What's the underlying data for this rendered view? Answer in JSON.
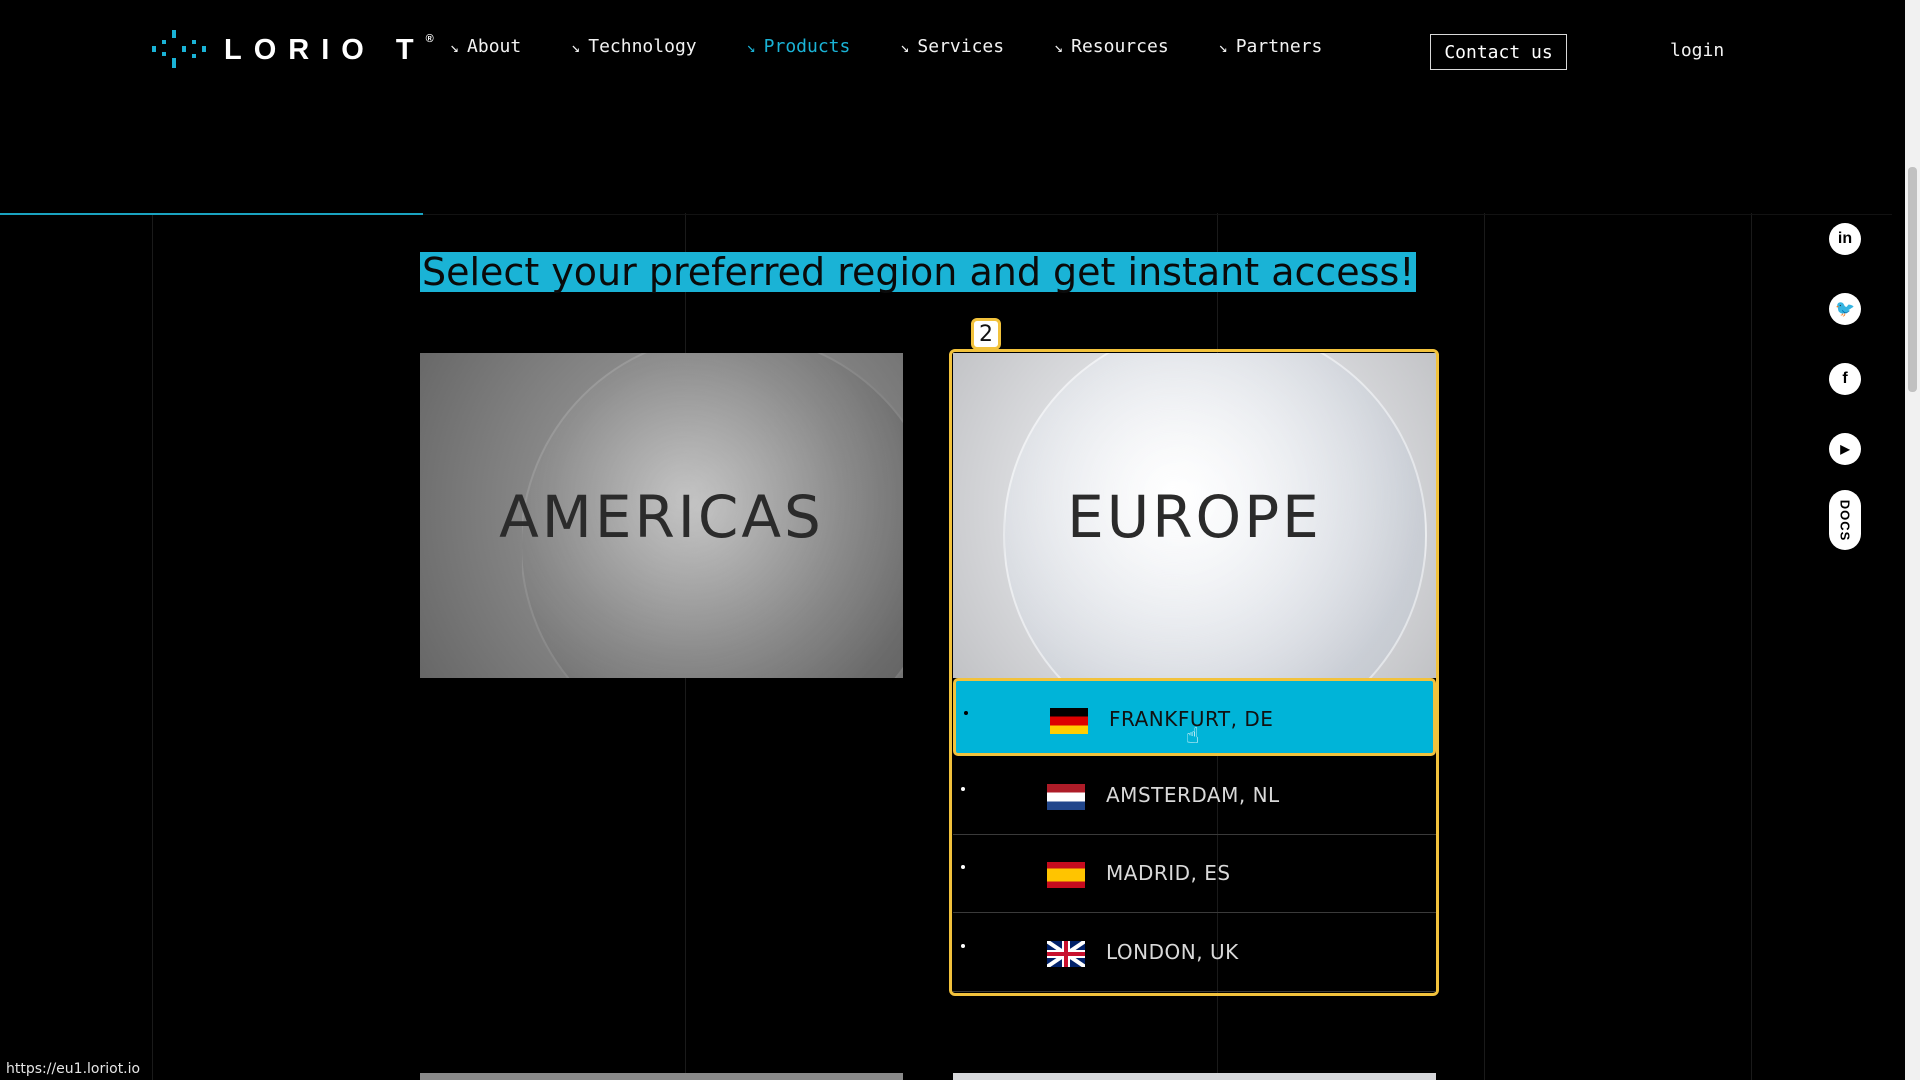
{
  "header": {
    "logo_text": "LORIO T",
    "logo_mark": "®",
    "nav": [
      {
        "label": "About"
      },
      {
        "label": "Technology"
      },
      {
        "label": "Products"
      },
      {
        "label": "Services"
      },
      {
        "label": "Resources"
      },
      {
        "label": "Partners"
      }
    ],
    "arrow_glyph": "↘",
    "contact_label": "Contact us",
    "login_label": "login"
  },
  "headline": "Select your preferred region and get instant access!",
  "regions": {
    "americas_title": "AMERICAS",
    "europe_title": "EUROPE"
  },
  "badge": "2",
  "locations": [
    {
      "label": "FRANKFURT, DE",
      "flag": "germany-flag-icon"
    },
    {
      "label": "AMSTERDAM, NL",
      "flag": "netherlands-flag-icon"
    },
    {
      "label": "MADRID, ES",
      "flag": "spain-flag-icon"
    },
    {
      "label": "LONDON, UK",
      "flag": "uk-flag-icon"
    }
  ],
  "social": {
    "linkedin": "in",
    "twitter": "🐦",
    "facebook": "f",
    "youtube": "▶",
    "docs": "DOCS"
  },
  "status_url": "https://eu1.loriot.io",
  "colors": {
    "accent": "#1ab3d6",
    "highlight": "#f2c23c",
    "background": "#000000"
  }
}
